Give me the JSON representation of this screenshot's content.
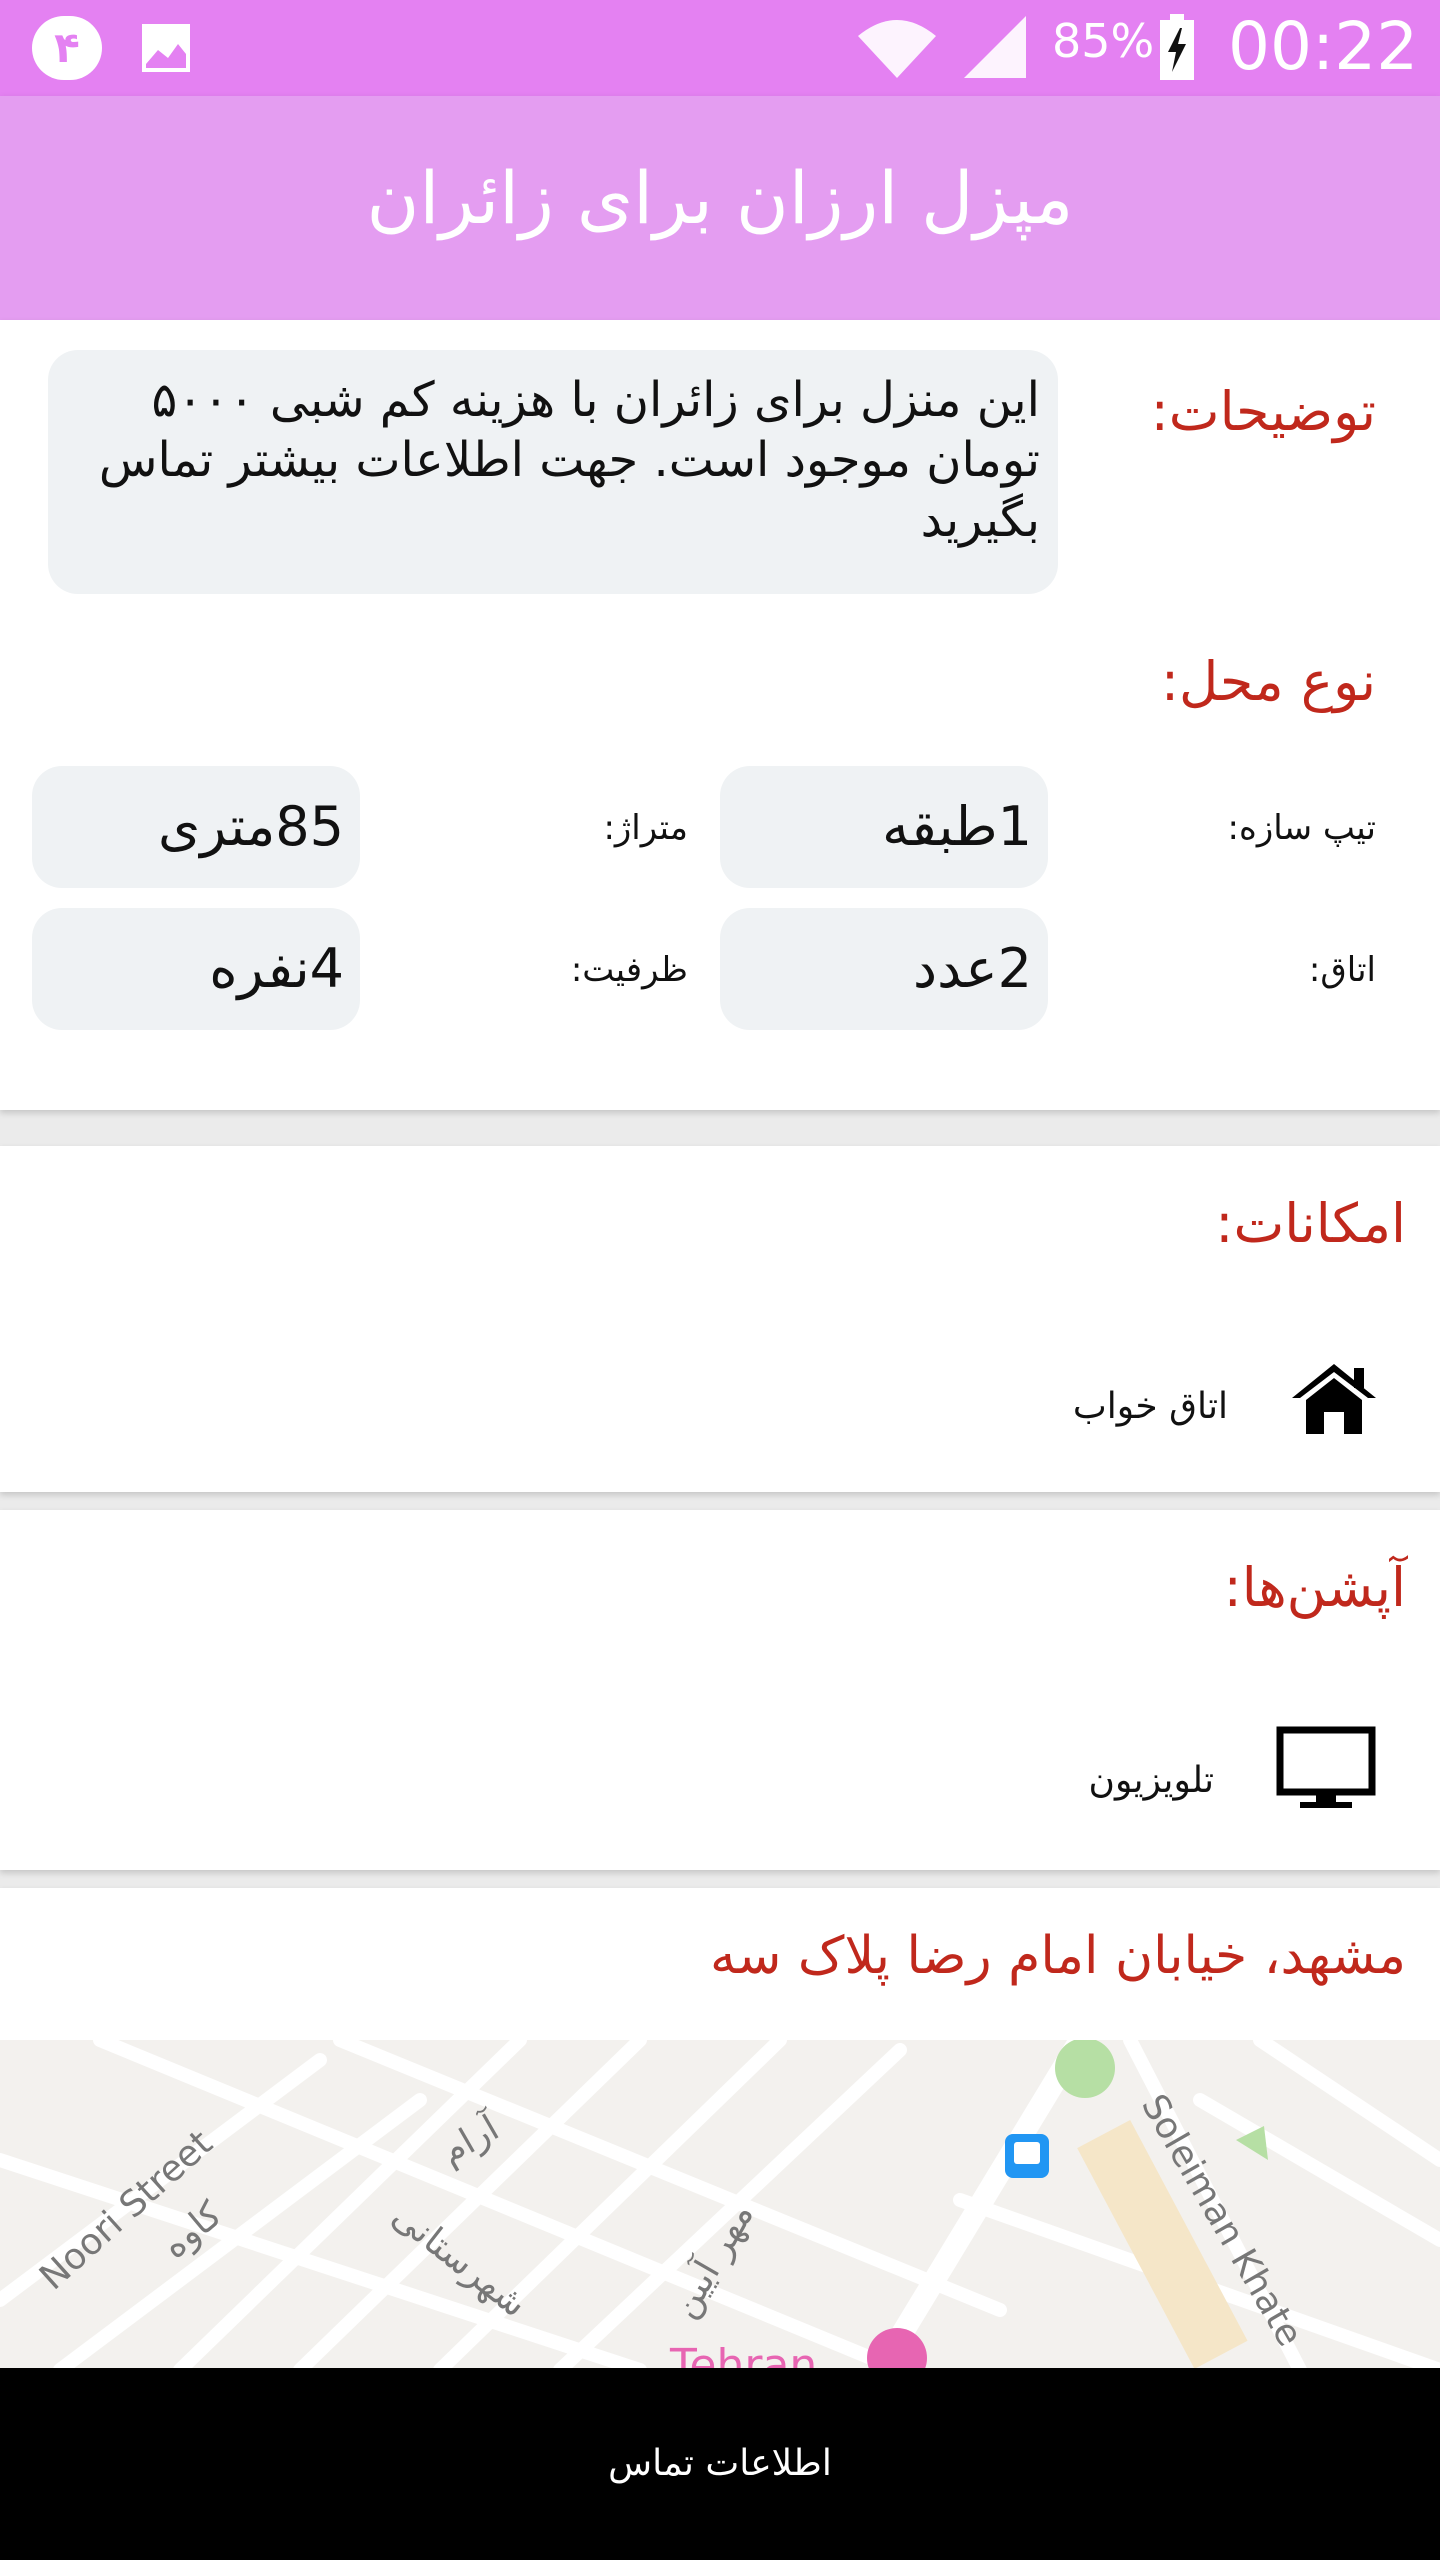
{
  "status_bar": {
    "badge": "۴",
    "battery_percent": "85%",
    "time": "00:22"
  },
  "app_bar": {
    "title": "مپزل ارزان برای زائران"
  },
  "details": {
    "description_label": "توضیحات:",
    "description_text": "این منزل برای زائران با هزینه کم شبی ۵۰۰۰ تومان موجود است. جهت اطلاعات بیشتر تماس بگیرید",
    "place_type_label": "نوع محل:",
    "fields": {
      "structure_label": "تیپ سازه:",
      "structure_value": "1طبقه",
      "area_label": "متراژ:",
      "area_value": "85متری",
      "rooms_label": "اتاق:",
      "rooms_value": "2عدد",
      "capacity_label": "ظرفیت:",
      "capacity_value": "4نفره"
    }
  },
  "amenities": {
    "title": "امکانات:",
    "items": [
      {
        "icon": "home-icon",
        "label": "اتاق خواب"
      }
    ]
  },
  "options": {
    "title": "آپشن‌ها:",
    "items": [
      {
        "icon": "tv-icon",
        "label": "تلویزیون"
      }
    ]
  },
  "location": {
    "address": "مشهد، خیابان امام رضا پلاک سه",
    "map_labels": {
      "noori": "Noori Street",
      "kaveh": "کاوه",
      "aram": "آرام",
      "shahrestani": "شهرستانی",
      "mehr": "مهر آیین",
      "soleiman": "Soleiman Khate",
      "tehran": "Tehran"
    }
  },
  "bottom_bar": {
    "contact_label": "اطلاعات تماس"
  },
  "colors": {
    "status_bar": "#e481f2",
    "app_bar": "#e49df1",
    "label_red": "#c0281c",
    "field_bg": "#eff2f4"
  }
}
